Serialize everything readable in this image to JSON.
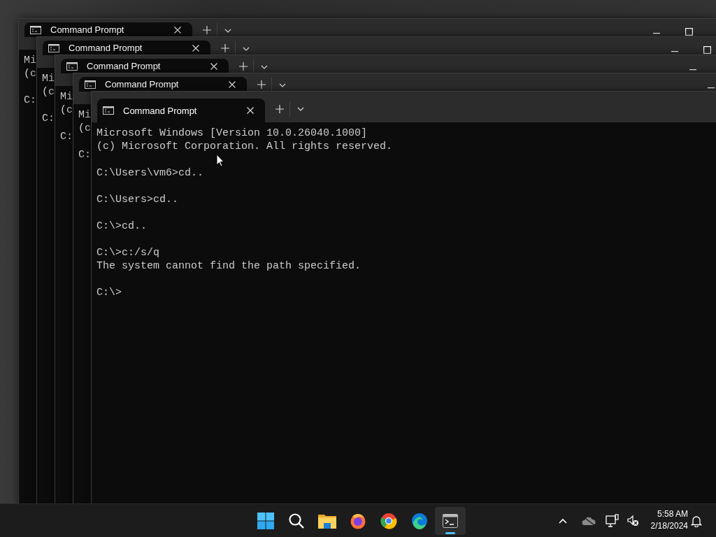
{
  "windows": [
    {
      "tab": {
        "title": "Command Prompt",
        "selected": true
      },
      "blocks": [
        [
          "Mi",
          "(c"
        ],
        [
          "C:"
        ]
      ]
    },
    {
      "tab": {
        "title": "Command Prompt",
        "selected": true
      },
      "blocks": [
        [
          "Mi",
          "(c"
        ],
        [
          "C:"
        ]
      ]
    },
    {
      "tab": {
        "title": "Command Prompt",
        "selected": true
      },
      "blocks": [
        [
          "Mi",
          "(c"
        ],
        [
          "C:"
        ]
      ]
    },
    {
      "tab": {
        "title": "Command Prompt",
        "selected": true
      },
      "blocks": [
        [
          "Mi",
          "(c"
        ],
        [
          "C:"
        ]
      ]
    },
    {
      "tab": {
        "title": "Command Prompt",
        "selected": true
      },
      "blocks": [
        [
          "Microsoft Windows [Version 10.0.26040.1000]",
          "(c) Microsoft Corporation. All rights reserved."
        ],
        [
          "C:\\Users\\vm6>cd.."
        ],
        [
          "C:\\Users>cd.."
        ],
        [
          "C:\\>cd.."
        ],
        [
          "C:\\>c:/s/q",
          "The system cannot find the path specified."
        ],
        [
          "C:\\>"
        ]
      ]
    }
  ],
  "taskbar": {
    "apps": [
      {
        "kind": "start"
      },
      {
        "kind": "search"
      },
      {
        "kind": "files"
      },
      {
        "kind": "firefox"
      },
      {
        "kind": "chrome"
      },
      {
        "kind": "edge"
      },
      {
        "kind": "terminal",
        "active": true
      }
    ],
    "clock": {
      "time": "5:58 AM",
      "date": "2/18/2024"
    }
  }
}
